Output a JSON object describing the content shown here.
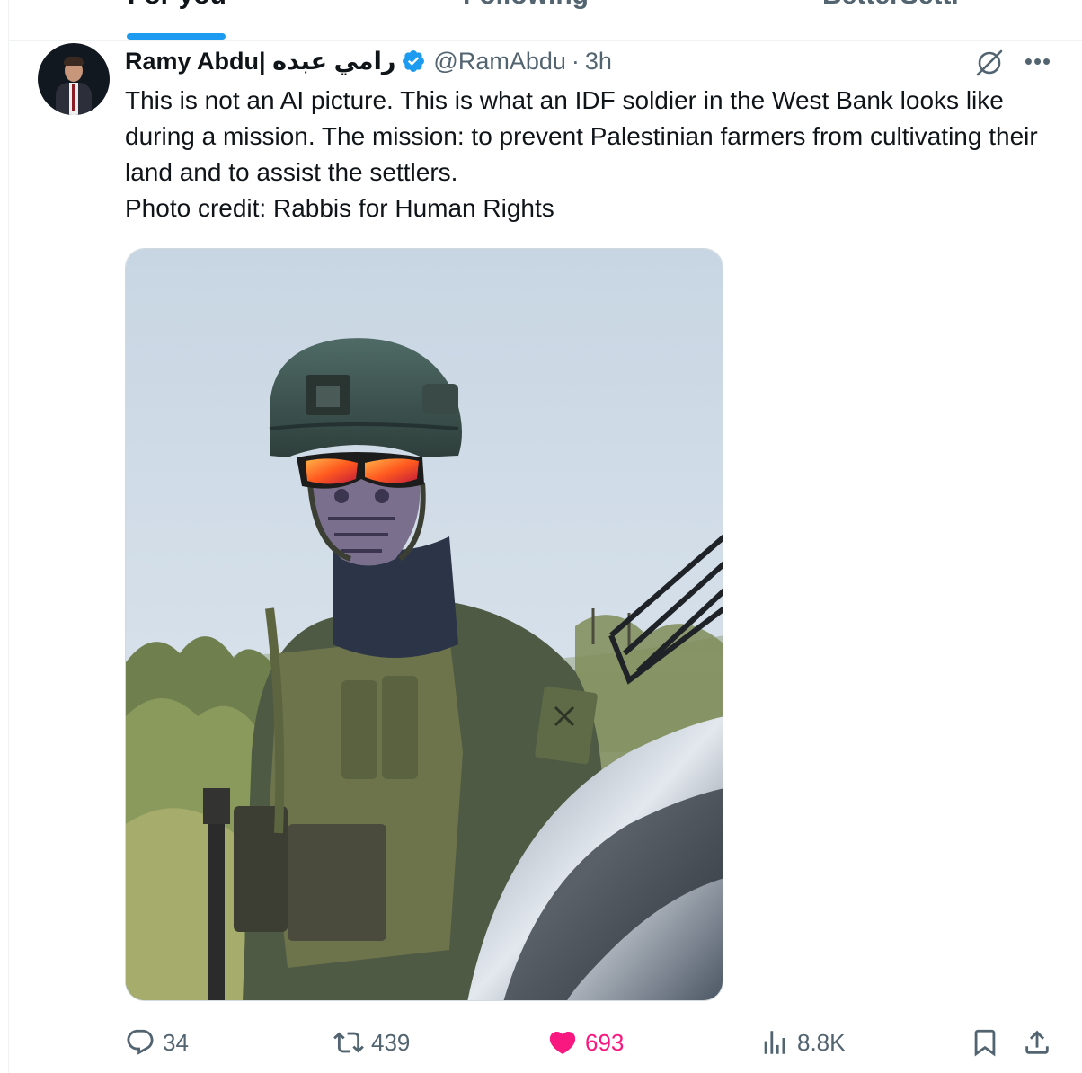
{
  "tabs": [
    {
      "label": "For you",
      "active": true
    },
    {
      "label": "Following",
      "active": false
    },
    {
      "label": "BetterSettl",
      "active": false
    }
  ],
  "tweet": {
    "display_name": "Ramy Abdu| رامي عبده",
    "handle": "@RamAbdu",
    "separator": "·",
    "time": "3h",
    "verified": true,
    "text_lines": [
      "This is not an AI picture. This is what an IDF soldier in the West Bank looks like during a mission. The mission: to prevent Palestinian farmers from cultivating their land and to assist the settlers.",
      "Photo credit: Rabbis for Human Rights"
    ],
    "media": {
      "kind": "photo",
      "subject": "soldier-photo"
    }
  },
  "actions": {
    "reply": {
      "icon": "reply-icon",
      "count": "34"
    },
    "retweet": {
      "icon": "retweet-icon",
      "count": "439"
    },
    "like": {
      "icon": "heart-icon",
      "count": "693",
      "liked": true
    },
    "views": {
      "icon": "views-icon",
      "count": "8.8K"
    },
    "bookmark": {
      "icon": "bookmark-icon"
    },
    "share": {
      "icon": "share-icon"
    }
  },
  "colors": {
    "accent": "#1d9bf0",
    "like": "#f91880",
    "secondary_text": "#536471",
    "primary_text": "#0f1419"
  }
}
